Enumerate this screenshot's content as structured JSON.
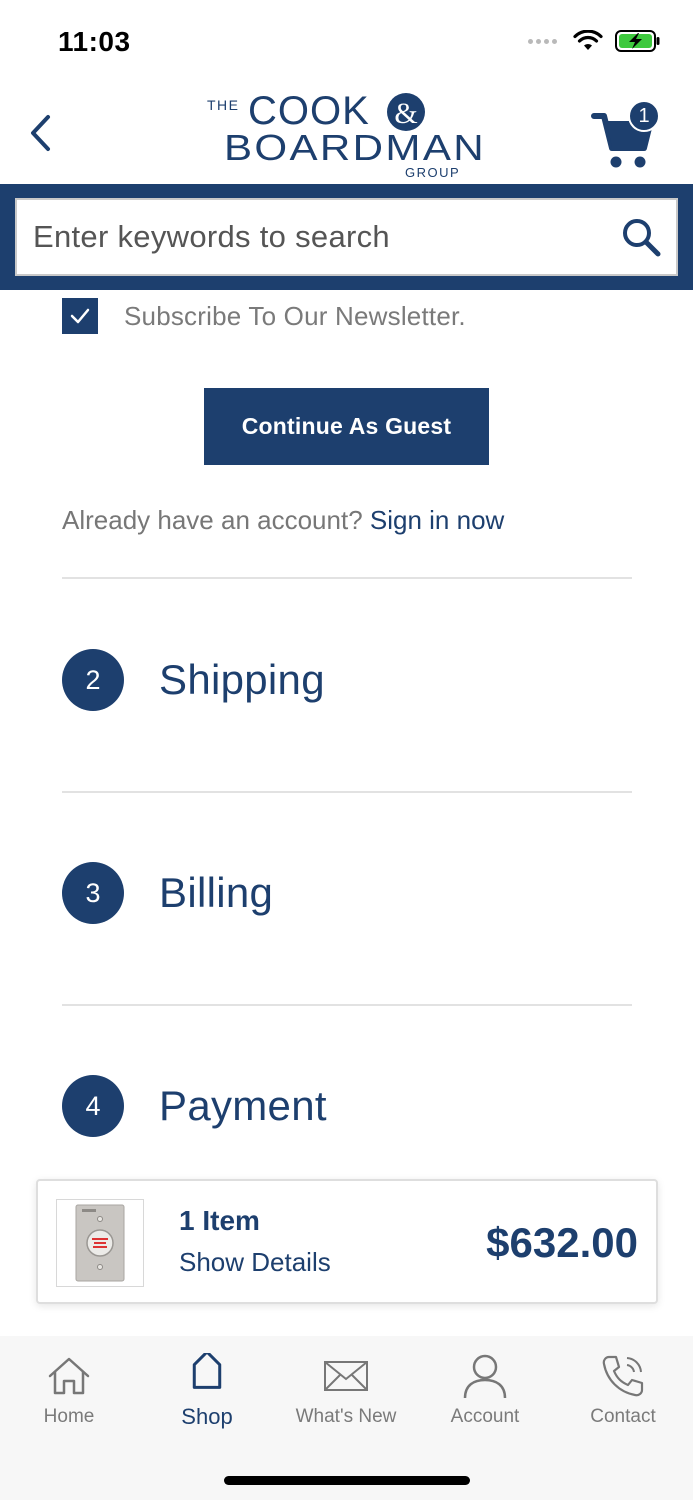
{
  "status_bar": {
    "time": "11:03"
  },
  "header": {
    "logo": {
      "the": "THE",
      "line1_a": "COOK",
      "amp": "&",
      "line2": "BOARDMAN",
      "group": "GROUP"
    },
    "cart_count": "1",
    "brand_color": "#1d3f6e"
  },
  "search": {
    "placeholder": "Enter keywords to search"
  },
  "newsletter": {
    "label": "Subscribe To Our Newsletter.",
    "checked": true
  },
  "guest_button": {
    "label": "Continue As Guest"
  },
  "signin": {
    "prompt": "Already have an account?",
    "link": "Sign in now"
  },
  "steps": [
    {
      "number": "2",
      "title": "Shipping"
    },
    {
      "number": "3",
      "title": "Billing"
    },
    {
      "number": "4",
      "title": "Payment"
    }
  ],
  "cart_summary": {
    "item_count": "1 Item",
    "details_link": "Show Details",
    "total": "$632.00"
  },
  "tabs": [
    {
      "label": "Home",
      "icon": "home-icon",
      "active": false
    },
    {
      "label": "Shop",
      "icon": "tag-icon",
      "active": true
    },
    {
      "label": "What's New",
      "icon": "envelope-icon",
      "active": false
    },
    {
      "label": "Account",
      "icon": "user-icon",
      "active": false
    },
    {
      "label": "Contact",
      "icon": "phone-icon",
      "active": false
    }
  ]
}
